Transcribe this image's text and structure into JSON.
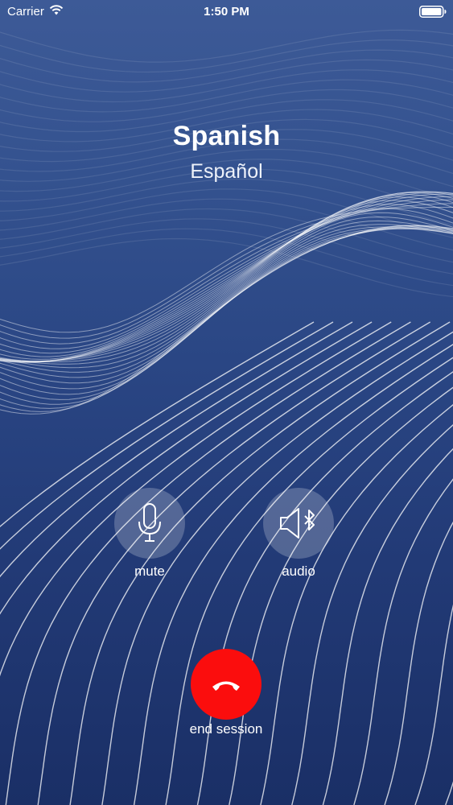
{
  "status_bar": {
    "carrier": "Carrier",
    "time": "1:50 PM",
    "wifi_icon": "wifi-icon",
    "battery_icon": "battery-icon"
  },
  "session": {
    "language": "Spanish",
    "language_native": "Español"
  },
  "controls": {
    "mute_label": "mute",
    "mute_icon": "microphone-icon",
    "audio_label": "audio",
    "audio_icon": "speaker-bluetooth-icon",
    "end_label": "end session",
    "end_icon": "phone-hangup-icon"
  },
  "colors": {
    "background_top": "#3d5a97",
    "background_bottom": "#1a2f66",
    "end_button": "#fb0d0d"
  }
}
